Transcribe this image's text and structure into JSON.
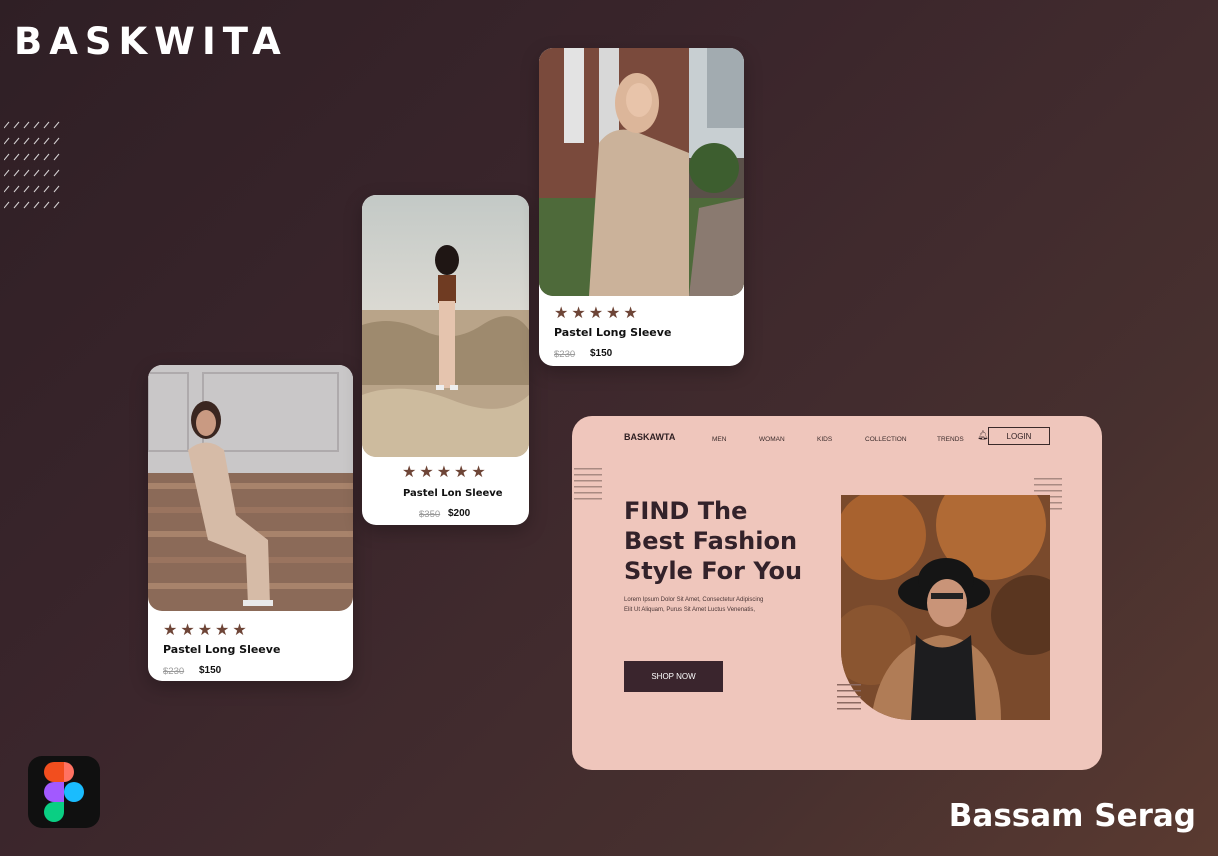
{
  "brand": "BASKWITA",
  "author": "Bassam Serag",
  "colors": {
    "accent": "#6e4537",
    "web_bg": "#efc6bc",
    "button": "#3a252d"
  },
  "cards": [
    {
      "rating": 5,
      "name": "Pastel Long Sleeve",
      "old_price": "$230",
      "price": "$150"
    },
    {
      "rating": 5,
      "name": "Pastel Lon Sleeve",
      "old_price": "$350",
      "price": "$200"
    },
    {
      "rating": 5,
      "name": "Pastel Long Sleeve",
      "old_price": "$230",
      "price": "$150"
    }
  ],
  "website": {
    "logo": "BASKAWTA",
    "nav": [
      "MEN",
      "WOMAN",
      "KIDS",
      "COLLECTION",
      "TRENDS"
    ],
    "login": "LOGIN",
    "hero_title": "FIND The Best Fashion Style For You",
    "hero_text": "Lorem Ipsum Dolor Sit Amet, Consectetur Adipiscing Elit Ut Aliquam, Purus Sit Amet Luctus Venenatis,",
    "cta": "SHOP NOW"
  },
  "icons": [
    "figma-icon",
    "bell-icon",
    "star-icon"
  ]
}
